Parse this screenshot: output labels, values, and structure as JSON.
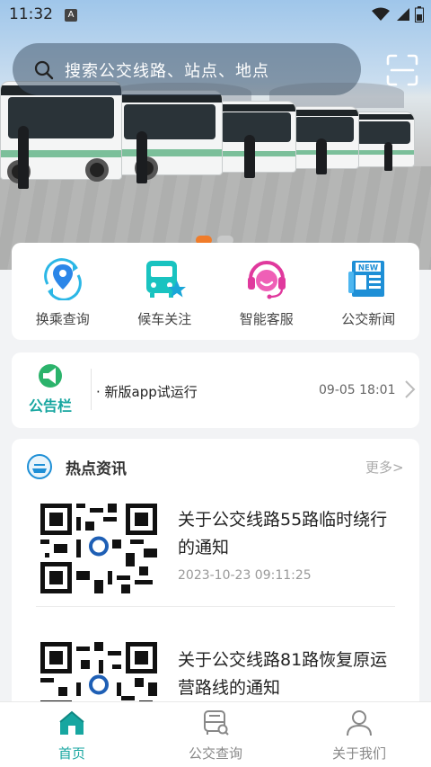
{
  "status_bar": {
    "time": "11:32",
    "notification_icon": "A"
  },
  "search": {
    "placeholder": "搜索公交线路、站点、地点"
  },
  "carousel": {
    "total": 2,
    "active_index": 0
  },
  "quick_actions": [
    {
      "label": "换乘查询",
      "icon": "transfer-query-icon"
    },
    {
      "label": "候车关注",
      "icon": "bus-wait-follow-icon"
    },
    {
      "label": "智能客服",
      "icon": "customer-service-icon"
    },
    {
      "label": "公交新闻",
      "icon": "bus-news-icon"
    }
  ],
  "notice": {
    "badge": "公告栏",
    "text": "· 新版app试运行",
    "time": "09-05 18:01"
  },
  "news": {
    "title": "热点资讯",
    "more": "更多>",
    "items": [
      {
        "headline": "关于公交线路55路临时绕行的通知",
        "date": "2023-10-23 09:11:25"
      },
      {
        "headline": "关于公交线路81路恢复原运营路线的通知",
        "date": ""
      }
    ]
  },
  "tabs": [
    {
      "label": "首页",
      "active": true
    },
    {
      "label": "公交查询",
      "active": false
    },
    {
      "label": "关于我们",
      "active": false
    }
  ],
  "colors": {
    "accent": "#17a6a0",
    "carousel_active": "#f07c2a"
  }
}
